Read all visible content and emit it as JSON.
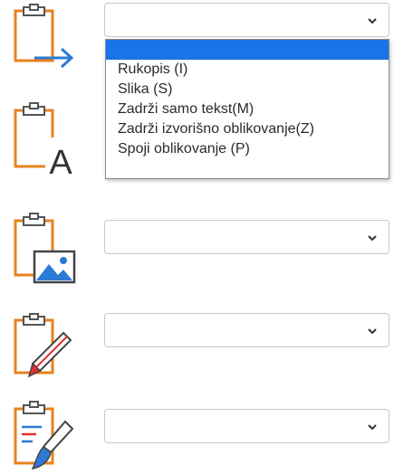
{
  "paste_options": [
    {
      "icon": "clipboard-arrow-icon",
      "selected_value": ""
    },
    {
      "icon": "clipboard-text-icon",
      "selected_value": ""
    },
    {
      "icon": "clipboard-picture-icon",
      "selected_value": ""
    },
    {
      "icon": "clipboard-pen-icon",
      "selected_value": ""
    },
    {
      "icon": "clipboard-brush-icon",
      "selected_value": ""
    }
  ],
  "dropdown": {
    "options": [
      "",
      "Rukopis (I)",
      "Slika (S)",
      "Zadrži samo tekst(M)",
      "Zadrži izvorišno oblikovanje(Z)",
      "Spoji oblikovanje (P)"
    ]
  },
  "colors": {
    "clipboard_orange": "#e8821f",
    "arrow_blue": "#2b7bd6",
    "highlight": "#1a73e8",
    "pen_red": "#e03030"
  }
}
